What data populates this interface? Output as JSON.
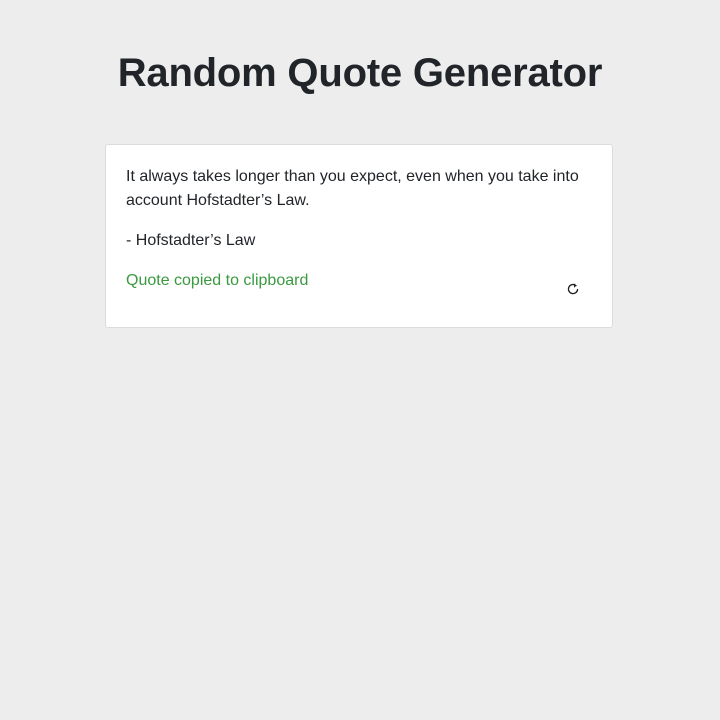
{
  "page": {
    "title": "Random Quote Generator"
  },
  "quote": {
    "text": "It always takes longer than you expect, even when you take into account Hofstadter’s Law.",
    "author": "- Hofstadter’s Law"
  },
  "status": {
    "message": "Quote copied to clipboard",
    "color": "#3a9a3f"
  },
  "controls": {
    "refresh_icon": "refresh-icon"
  }
}
